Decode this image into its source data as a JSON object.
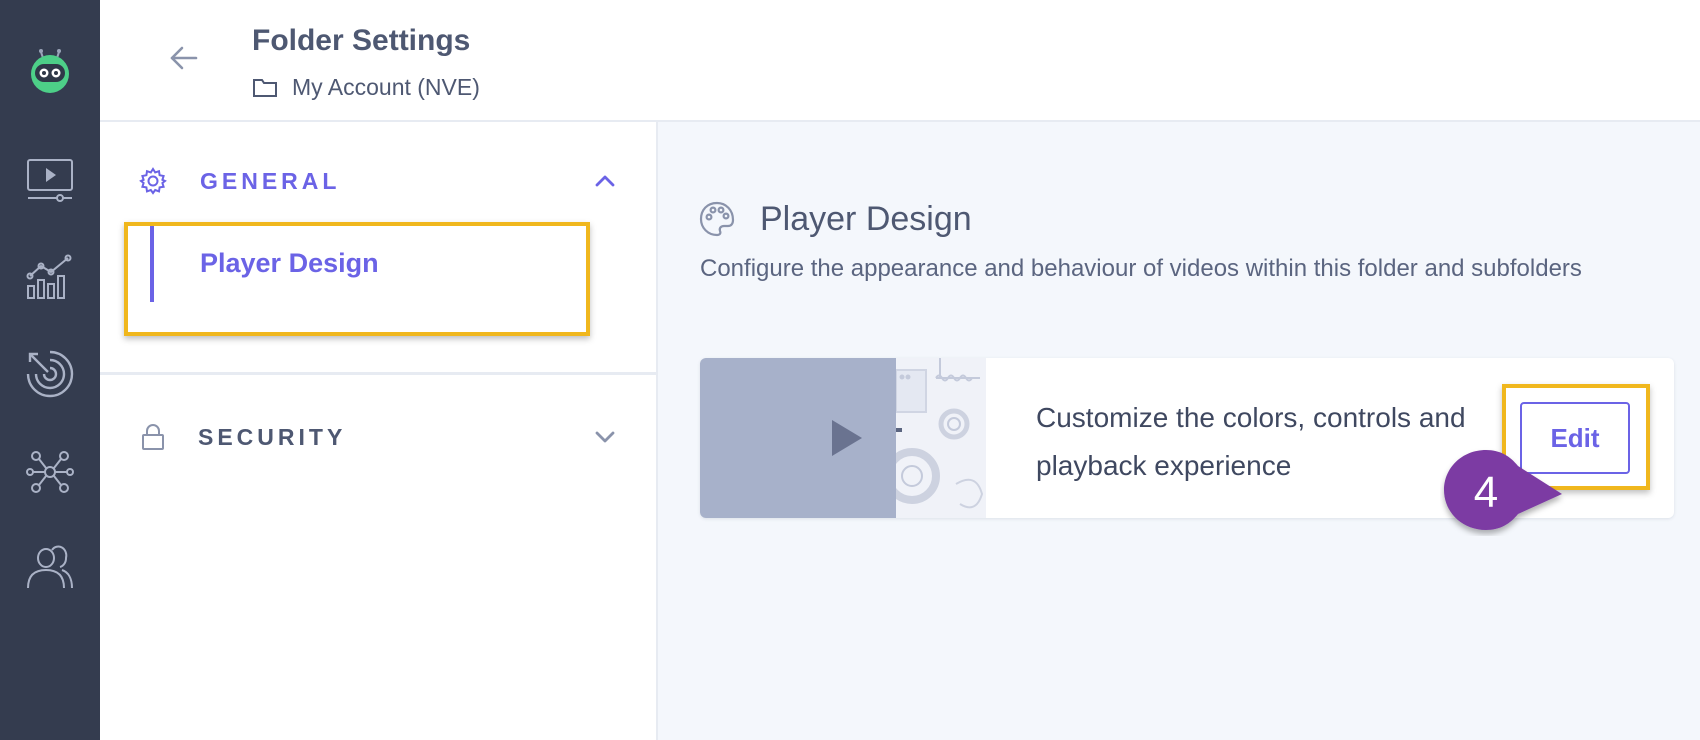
{
  "header": {
    "title": "Folder Settings",
    "breadcrumb": "My Account (NVE)"
  },
  "rail": {
    "items": [
      {
        "icon": "robot-logo-icon"
      },
      {
        "icon": "video-library-icon"
      },
      {
        "icon": "analytics-icon"
      },
      {
        "icon": "targeting-icon"
      },
      {
        "icon": "integrations-icon"
      },
      {
        "icon": "users-icon"
      }
    ]
  },
  "sidebar": {
    "general": {
      "label": "GENERAL",
      "expanded": true,
      "items": [
        {
          "label": "Player Design",
          "active": true
        }
      ]
    },
    "security": {
      "label": "SECURITY",
      "expanded": false
    }
  },
  "main": {
    "title": "Player Design",
    "description": "Configure the appearance and behaviour of videos within this folder and subfolders",
    "card": {
      "text": "Customize the colors, controls and playback experience",
      "edit_label": "Edit"
    }
  },
  "annotation": {
    "step": "4"
  },
  "colors": {
    "accent": "#6b63e6",
    "rail": "#343c4f",
    "highlight": "#f0b71d",
    "badge": "#7b3aa3",
    "main_bg": "#f4f7fc"
  }
}
